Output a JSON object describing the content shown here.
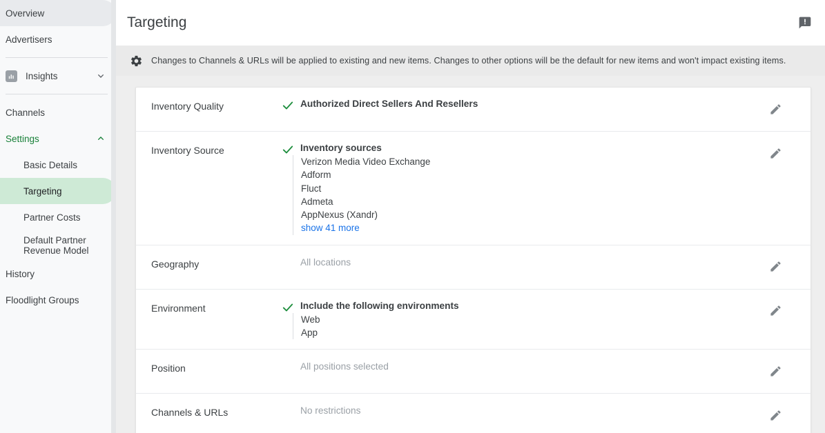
{
  "sidebar": {
    "items": [
      {
        "label": "Overview",
        "state": "active-grey",
        "type": "top"
      },
      {
        "label": "Advertisers",
        "state": "",
        "type": "top"
      },
      {
        "label": "Insights",
        "state": "",
        "type": "icon-expand",
        "icon": "bar-chart-icon",
        "chevron": "chevron-down-icon"
      },
      {
        "label": "Channels",
        "state": "",
        "type": "top"
      },
      {
        "label": "Settings",
        "state": "green",
        "type": "expand",
        "chevron": "chevron-up-icon"
      },
      {
        "label": "Basic Details",
        "state": "",
        "type": "sub"
      },
      {
        "label": "Targeting",
        "state": "active-green",
        "type": "sub"
      },
      {
        "label": "Partner Costs",
        "state": "",
        "type": "sub"
      },
      {
        "label": "Default Partner Revenue Model",
        "state": "",
        "type": "sub-two"
      },
      {
        "label": "History",
        "state": "",
        "type": "top"
      },
      {
        "label": "Floodlight Groups",
        "state": "",
        "type": "top"
      }
    ]
  },
  "header": {
    "title": "Targeting",
    "feedback_icon": "feedback-icon"
  },
  "banner": {
    "icon": "gear-icon",
    "text": "Changes to Channels & URLs will be applied to existing and new items. Changes to other options will be the default for new items and won't impact existing items."
  },
  "rows": [
    {
      "label": "Inventory Quality",
      "checked": true,
      "value": "Authorized Direct Sellers And Resellers",
      "muted": false,
      "sublist": [],
      "edit_icon": "pencil-icon"
    },
    {
      "label": "Inventory Source",
      "checked": true,
      "value": "Inventory sources",
      "muted": false,
      "sublist": [
        {
          "text": "Verizon Media Video Exchange",
          "link": false
        },
        {
          "text": "Adform",
          "link": false
        },
        {
          "text": "Fluct",
          "link": false
        },
        {
          "text": "Admeta",
          "link": false
        },
        {
          "text": "AppNexus (Xandr)",
          "link": false
        },
        {
          "text": "show 41 more",
          "link": true
        }
      ],
      "edit_icon": "pencil-icon"
    },
    {
      "label": "Geography",
      "checked": false,
      "value": "All locations",
      "muted": true,
      "sublist": [],
      "edit_icon": "pencil-icon"
    },
    {
      "label": "Environment",
      "checked": true,
      "value": "Include the following environments",
      "muted": false,
      "sublist": [
        {
          "text": "Web",
          "link": false
        },
        {
          "text": "App",
          "link": false
        }
      ],
      "edit_icon": "pencil-icon"
    },
    {
      "label": "Position",
      "checked": false,
      "value": "All positions selected",
      "muted": true,
      "sublist": [],
      "edit_icon": "pencil-icon"
    },
    {
      "label": "Channels & URLs",
      "checked": false,
      "value": "No restrictions",
      "muted": true,
      "sublist": [],
      "edit_icon": "pencil-icon"
    }
  ],
  "colors": {
    "accent_green": "#188038",
    "check_green": "#1e8e3e",
    "pill_green": "#ceead6",
    "link_blue": "#1a73e8",
    "muted_grey": "#9aa0a6",
    "text_grey": "#3c4043",
    "banner_bg": "#eaeaea",
    "page_bg": "#eeeeee"
  }
}
